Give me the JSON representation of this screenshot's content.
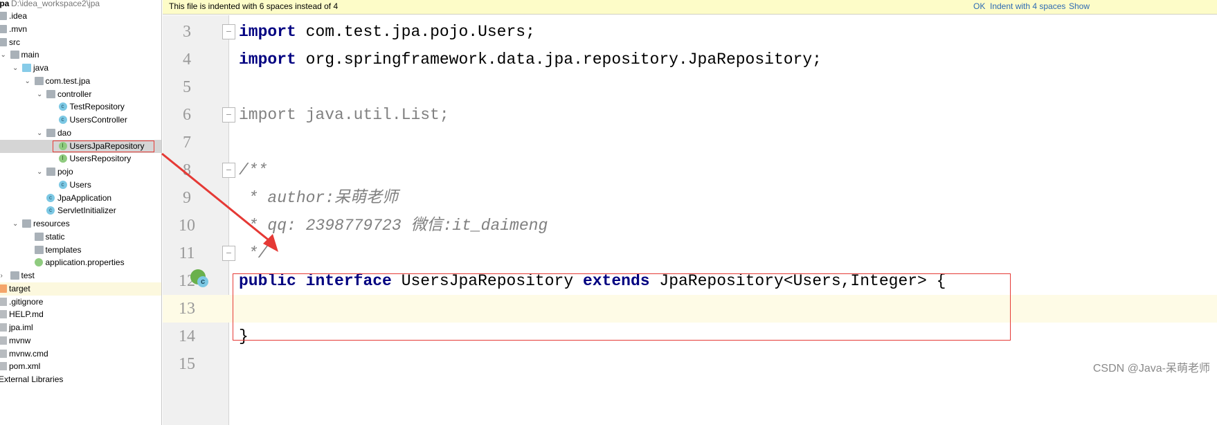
{
  "project": {
    "name": "jpa",
    "path": "D:\\idea_workspace2\\jpa"
  },
  "tree": [
    {
      "label": ".idea",
      "level": 0,
      "icon": "folder-icon"
    },
    {
      "label": ".mvn",
      "level": 0,
      "icon": "folder-icon"
    },
    {
      "label": "src",
      "level": 0,
      "icon": "folder-icon"
    },
    {
      "label": "main",
      "level": 1,
      "icon": "folder-icon",
      "expanded": true
    },
    {
      "label": "java",
      "level": 2,
      "icon": "source-folder-icon",
      "expanded": true
    },
    {
      "label": "com.test.jpa",
      "level": 3,
      "icon": "package-icon",
      "expanded": true
    },
    {
      "label": "controller",
      "level": 4,
      "icon": "package-icon",
      "expanded": true
    },
    {
      "label": "TestRepository",
      "level": 5,
      "icon": "class-icon"
    },
    {
      "label": "UsersController",
      "level": 5,
      "icon": "class-icon"
    },
    {
      "label": "dao",
      "level": 4,
      "icon": "package-icon",
      "expanded": true
    },
    {
      "label": "UsersJpaRepository",
      "level": 5,
      "icon": "interface-icon",
      "selected": true
    },
    {
      "label": "UsersRepository",
      "level": 5,
      "icon": "interface-icon"
    },
    {
      "label": "pojo",
      "level": 4,
      "icon": "package-icon",
      "expanded": true
    },
    {
      "label": "Users",
      "level": 5,
      "icon": "class-icon"
    },
    {
      "label": "JpaApplication",
      "level": 4,
      "icon": "spring-boot-class-icon"
    },
    {
      "label": "ServletInitializer",
      "level": 4,
      "icon": "class-icon"
    },
    {
      "label": "resources",
      "level": 2,
      "icon": "resources-folder-icon",
      "expanded": true
    },
    {
      "label": "static",
      "level": 3,
      "icon": "folder-icon"
    },
    {
      "label": "templates",
      "level": 3,
      "icon": "folder-icon"
    },
    {
      "label": "application.properties",
      "level": 3,
      "icon": "spring-properties-icon"
    },
    {
      "label": "test",
      "level": 1,
      "icon": "folder-icon",
      "collapsed": true
    },
    {
      "label": "target",
      "level": 0,
      "icon": "excluded-folder-icon",
      "highlight": true
    },
    {
      "label": ".gitignore",
      "level": 0,
      "icon": "text-file-icon"
    },
    {
      "label": "HELP.md",
      "level": 0,
      "icon": "markdown-file-icon"
    },
    {
      "label": "jpa.iml",
      "level": 0,
      "icon": "module-file-icon"
    },
    {
      "label": "mvnw",
      "level": 0,
      "icon": "file-icon"
    },
    {
      "label": "mvnw.cmd",
      "level": 0,
      "icon": "file-icon"
    },
    {
      "label": "pom.xml",
      "level": 0,
      "icon": "maven-icon"
    },
    {
      "label": "External Libraries",
      "level": -1,
      "icon": "library-icon"
    }
  ],
  "banner": {
    "message": "This file is indented with 6 spaces instead of 4",
    "ok": "OK",
    "indent": "Indent with 4 spaces",
    "show": "Show"
  },
  "code": [
    {
      "n": "3",
      "parts": [
        [
          "kw",
          "import"
        ],
        [
          "",
          "com.test.jpa.pojo.Users;"
        ]
      ],
      "fold": "start"
    },
    {
      "n": "4",
      "parts": [
        [
          "kw",
          "import"
        ],
        [
          "",
          "org.springframework.data.jpa.repository.JpaRepository;"
        ]
      ]
    },
    {
      "n": "5",
      "parts": []
    },
    {
      "n": "6",
      "parts": [
        [
          "gray",
          "import java.util.List;"
        ]
      ],
      "fold": "end"
    },
    {
      "n": "7",
      "parts": []
    },
    {
      "n": "8",
      "parts": [
        [
          "cmt",
          "/**"
        ]
      ],
      "fold": "start"
    },
    {
      "n": "9",
      "parts": [
        [
          "cmt",
          " * author:呆萌老师"
        ]
      ]
    },
    {
      "n": "10",
      "parts": [
        [
          "cmt",
          " * qq: 2398779723 微信:it_daimeng"
        ]
      ]
    },
    {
      "n": "11",
      "parts": [
        [
          "cmt",
          " */"
        ]
      ],
      "fold": "end"
    },
    {
      "n": "12",
      "parts": [
        [
          "kw",
          "public"
        ],
        [
          "kw",
          "interface"
        ],
        [
          "",
          "UsersJpaRepository"
        ],
        [
          "kw",
          "extends"
        ],
        [
          "",
          "JpaRepository<Users,Integer> {"
        ]
      ]
    },
    {
      "n": "13",
      "parts": [],
      "current": true
    },
    {
      "n": "14",
      "parts": [
        [
          "",
          "}"
        ]
      ]
    },
    {
      "n": "15",
      "parts": []
    }
  ],
  "watermark": "CSDN @Java-呆萌老师",
  "colors": {
    "annotation": "#e53935",
    "keyword": "#000080",
    "banner": "#fdfcc8"
  }
}
